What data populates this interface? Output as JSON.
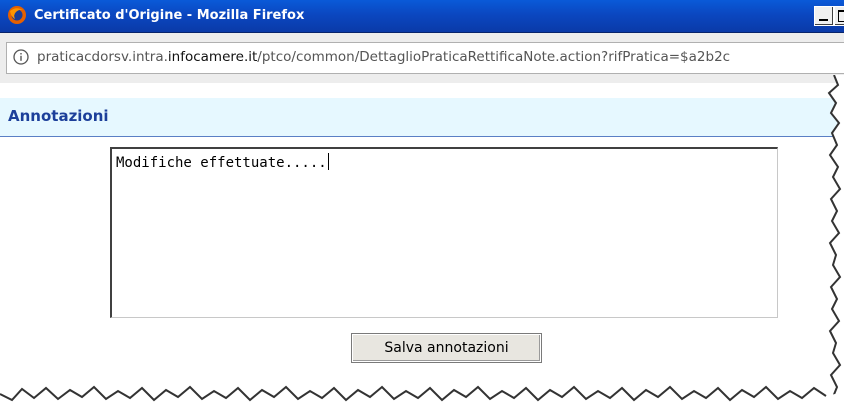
{
  "window": {
    "title": "Certificato d'Origine - Mozilla Firefox"
  },
  "urlbar": {
    "prefix": "praticacdorsv.intra.",
    "domain": "infocamere.it",
    "path": "/ptco/common/DettaglioPraticaRettificaNote.action?rifPratica=$a2b2c"
  },
  "section": {
    "title": "Annotazioni"
  },
  "notes": {
    "value": "Modifiche effettuate....."
  },
  "actions": {
    "save_label": "Salva annotazioni"
  },
  "colors": {
    "titlebar": "#0b47c0",
    "section_bg": "#e6f8ff",
    "section_title": "#1c3f9a"
  }
}
